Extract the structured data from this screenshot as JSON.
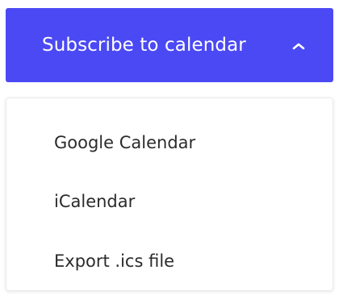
{
  "subscribe_button": {
    "label": "Subscribe to calendar",
    "icon": "chevron-up-icon",
    "background_color": "#4b49f4",
    "text_color": "#ffffff"
  },
  "menu": {
    "items": [
      {
        "label": "Google Calendar"
      },
      {
        "label": "iCalendar"
      },
      {
        "label": "Export .ics file"
      }
    ]
  }
}
